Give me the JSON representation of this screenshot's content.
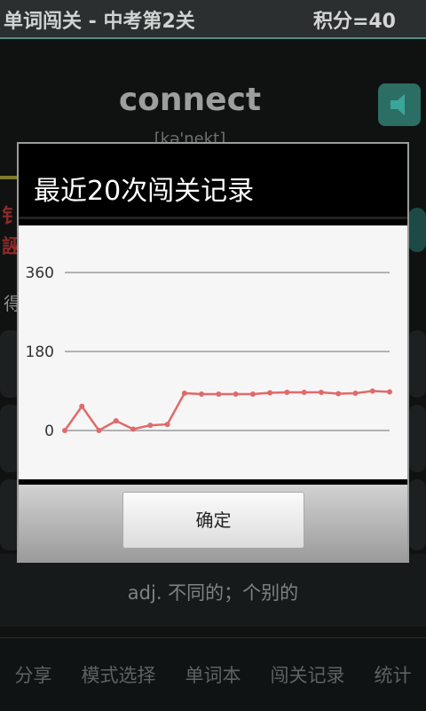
{
  "header": {
    "title": "单词闯关 - 中考第2关",
    "score": "积分=40"
  },
  "word_card": {
    "word": "connect",
    "phonetic": "[kə'nekt]",
    "speaker_icon": "speaker-icon"
  },
  "background_partial": {
    "red_line_1": "钅",
    "red_line_2": "誣",
    "score_label": "得"
  },
  "meaning": "adj. 不同的；个别的",
  "bottom_tabs": [
    "分享",
    "模式选择",
    "单词本",
    "闯关记录",
    "统计"
  ],
  "dialog": {
    "title": "最近20次闯关记录",
    "ok_label": "确定"
  },
  "chart_data": {
    "type": "line",
    "title": "",
    "xlabel": "",
    "ylabel": "",
    "yticks": [
      0,
      180,
      360
    ],
    "ylim": [
      -20,
      400
    ],
    "x": [
      1,
      2,
      3,
      4,
      5,
      6,
      7,
      8,
      9,
      10,
      11,
      12,
      13,
      14,
      15,
      16,
      17,
      18,
      19,
      20
    ],
    "series": [
      {
        "values": [
          0,
          55,
          0,
          22,
          3,
          12,
          14,
          85,
          83,
          83,
          83,
          83,
          86,
          87,
          87,
          87,
          84,
          85,
          90,
          88
        ]
      }
    ],
    "line_color": "#e06a6a",
    "grid": true
  }
}
